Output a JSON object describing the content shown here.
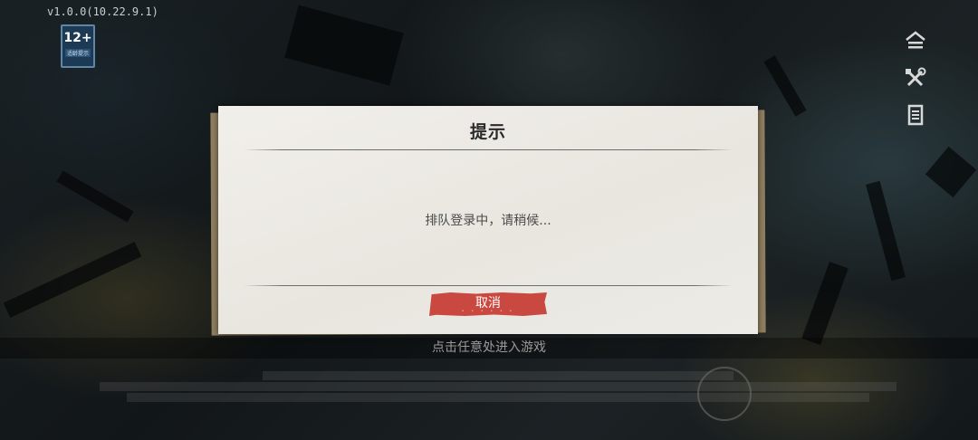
{
  "version": "v1.0.0(10.22.9.1)",
  "age_rating": {
    "number": "12+",
    "label": "适龄提示"
  },
  "right_icons": [
    "notice-icon",
    "repair-tool-icon",
    "document-icon"
  ],
  "tap_prompt": "点击任意处进入游戏",
  "dialog": {
    "title": "提示",
    "message": "排队登录中，请稍候...",
    "cancel_label": "取消",
    "cancel_color": "#c9483f"
  }
}
